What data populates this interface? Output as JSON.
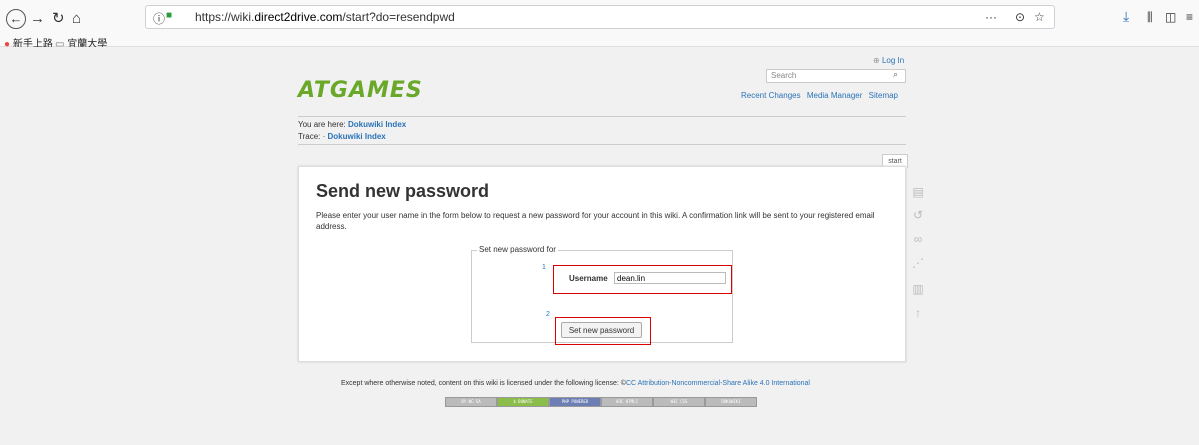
{
  "browser": {
    "url_prefix": "https://wiki.",
    "url_domain": "direct2drive.com",
    "url_path": "/start?do=resendpwd",
    "info_icon": "ⓘ",
    "lock_icon": "🔒",
    "more_icon": "···",
    "pocket_icon": "⊙",
    "star_icon": "☆",
    "download_icon": "⤓",
    "library_icon": "⫼",
    "sidebar_icon": "◫",
    "menu_icon": "≡",
    "back_icon": "←",
    "forward_icon": "→",
    "reload_icon": "↻",
    "home_icon": "⌂"
  },
  "bookmarks": [
    {
      "label": "新手上路"
    },
    {
      "label": "宜蘭大學"
    }
  ],
  "header": {
    "logo_text": "ATGAMES",
    "login": "Log In",
    "search_placeholder": "Search",
    "tools": [
      "Recent Changes",
      "Media Manager",
      "Sitemap"
    ]
  },
  "breadcrumbs": {
    "you_are_here_label": "You are here:",
    "you_are_here_link": "Dokuwiki Index",
    "trace_label": "Trace: ·",
    "trace_link": "Dokuwiki Index"
  },
  "tab": "start",
  "main": {
    "title": "Send new password",
    "description": "Please enter your user name in the form below to request a new password for your account in this wiki. A confirmation link will be sent to your registered email address.",
    "legend": "Set new password for",
    "step1": "1",
    "step2": "2",
    "username_label": "Username",
    "username_value": "dean.lin",
    "submit_label": "Set new password"
  },
  "footer": {
    "license_text": "Except where otherwise noted, content on this wiki is licensed under the following license:",
    "license_link": "CC Attribution-Noncommercial-Share Alike 4.0 International",
    "badges": [
      "BY-NC-SA",
      "$ DONATE",
      "PHP POWERED",
      "W3C HTML5",
      "W3C CSS",
      "DOKUWIKI"
    ]
  }
}
